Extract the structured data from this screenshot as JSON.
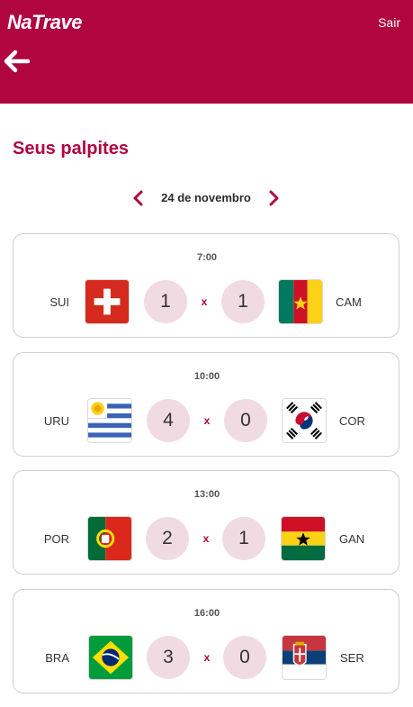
{
  "app": {
    "logo": "NaTrave",
    "logout_label": "Sair"
  },
  "page": {
    "title": "Seus palpites"
  },
  "date_nav": {
    "label": "24 de novembro"
  },
  "games": [
    {
      "time": "7:00",
      "home": {
        "code": "SUI",
        "flag": "switzerland-flag"
      },
      "home_score": "1",
      "separator": "x",
      "away_score": "1",
      "away": {
        "code": "CAM",
        "flag": "cameroon-flag"
      }
    },
    {
      "time": "10:00",
      "home": {
        "code": "URU",
        "flag": "uruguay-flag"
      },
      "home_score": "4",
      "separator": "x",
      "away_score": "0",
      "away": {
        "code": "COR",
        "flag": "south-korea-flag"
      }
    },
    {
      "time": "13:00",
      "home": {
        "code": "POR",
        "flag": "portugal-flag"
      },
      "home_score": "2",
      "separator": "x",
      "away_score": "1",
      "away": {
        "code": "GAN",
        "flag": "ghana-flag"
      }
    },
    {
      "time": "16:00",
      "home": {
        "code": "BRA",
        "flag": "brazil-flag"
      },
      "home_score": "3",
      "separator": "x",
      "away_score": "0",
      "away": {
        "code": "SER",
        "flag": "serbia-flag"
      }
    }
  ],
  "colors": {
    "brand": "#b0053f",
    "score_bg": "#f1dbe2",
    "card_border": "#cfcfcf"
  }
}
